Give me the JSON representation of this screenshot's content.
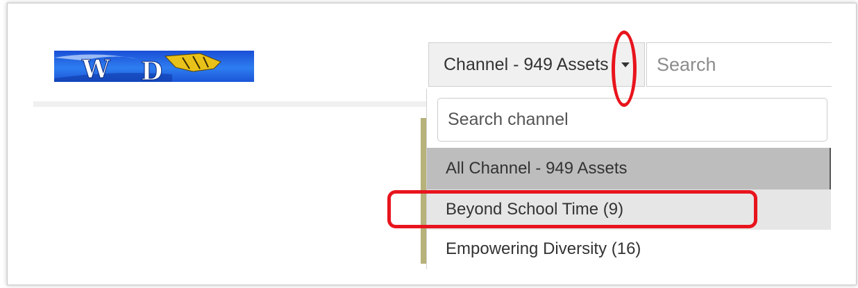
{
  "logo": {
    "text": "W D",
    "alt": "WPD logo"
  },
  "header": {
    "channel_button_label": "Channel - 949 Assets",
    "search_placeholder": "Search"
  },
  "dropdown": {
    "search_placeholder": "Search channel",
    "items": [
      {
        "label": "All Channel - 949 Assets",
        "state": "selected"
      },
      {
        "label": "Beyond School Time (9)",
        "state": "hover"
      },
      {
        "label": "Empowering Diversity (16)",
        "state": "normal"
      }
    ]
  },
  "colors": {
    "annotation": "#e8141d",
    "selected_bg": "#bdbdbd",
    "hover_bg": "#e6e6e6"
  }
}
